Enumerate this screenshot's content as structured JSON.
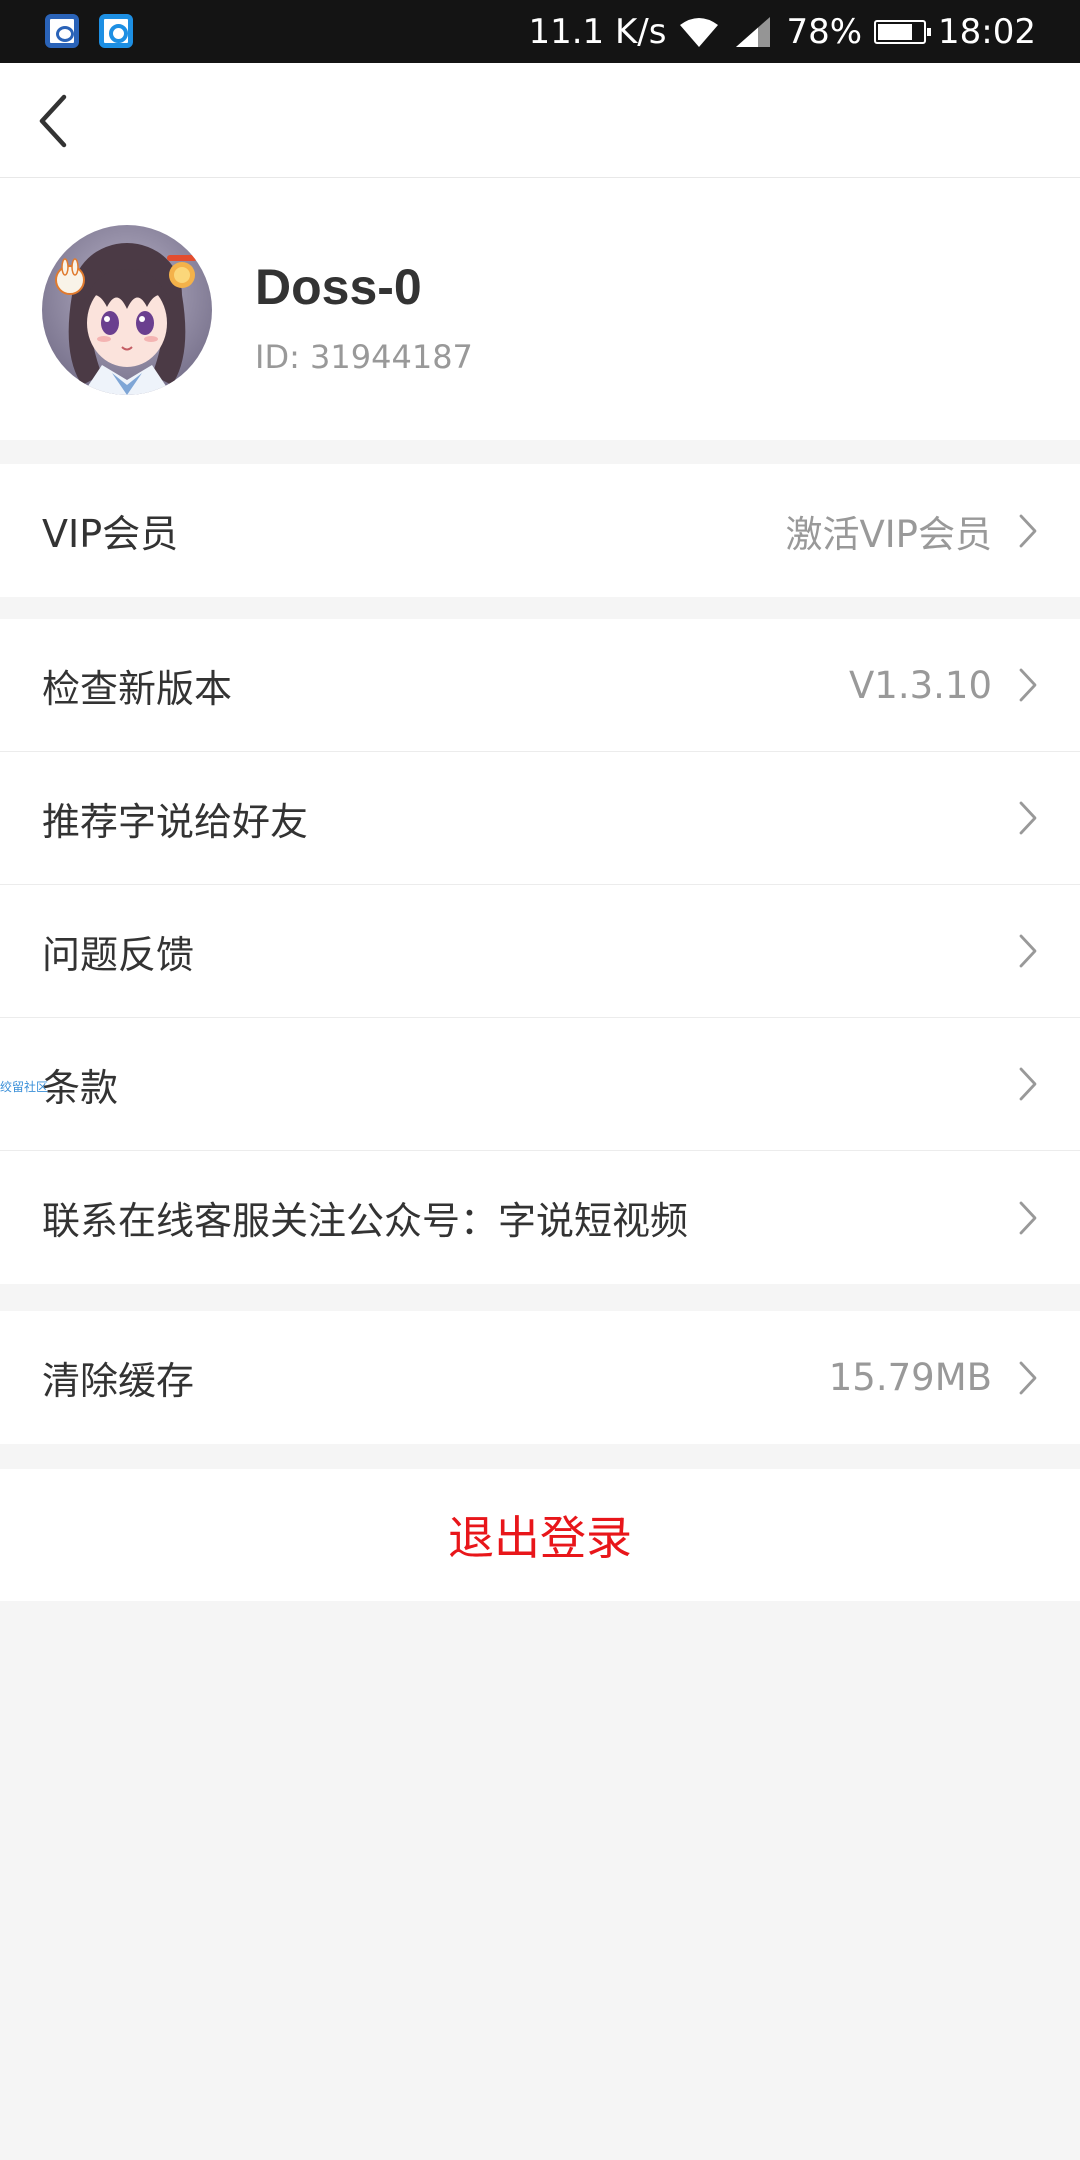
{
  "status_bar": {
    "network_speed": "11.1 K/s",
    "battery_percent": "78%",
    "battery_level": 0.78,
    "time": "18:02",
    "icons": [
      "app-icon-du",
      "app-icon-q",
      "wifi-icon",
      "signal-icon",
      "battery-icon"
    ]
  },
  "nav": {
    "back_icon": "chevron-left-icon"
  },
  "profile": {
    "username": "Doss-0",
    "id_text": "ID: 31944187"
  },
  "vip": {
    "label": "VIP会员",
    "value": "激活VIP会员"
  },
  "settings": [
    {
      "label": "检查新版本",
      "value": "V1.3.10"
    },
    {
      "label": "推荐字说给好友",
      "value": ""
    },
    {
      "label": "问题反馈",
      "value": ""
    },
    {
      "label": "条款",
      "value": ""
    },
    {
      "label": "联系在线客服关注公众号：字说短视频",
      "value": ""
    }
  ],
  "watermark": "绞留社区",
  "cache": {
    "label": "清除缓存",
    "value": "15.79MB"
  },
  "logout": {
    "label": "退出登录"
  },
  "colors": {
    "logout_red": "#e8161a",
    "page_background": "#f5f5f5",
    "status_bar": "#141414"
  }
}
